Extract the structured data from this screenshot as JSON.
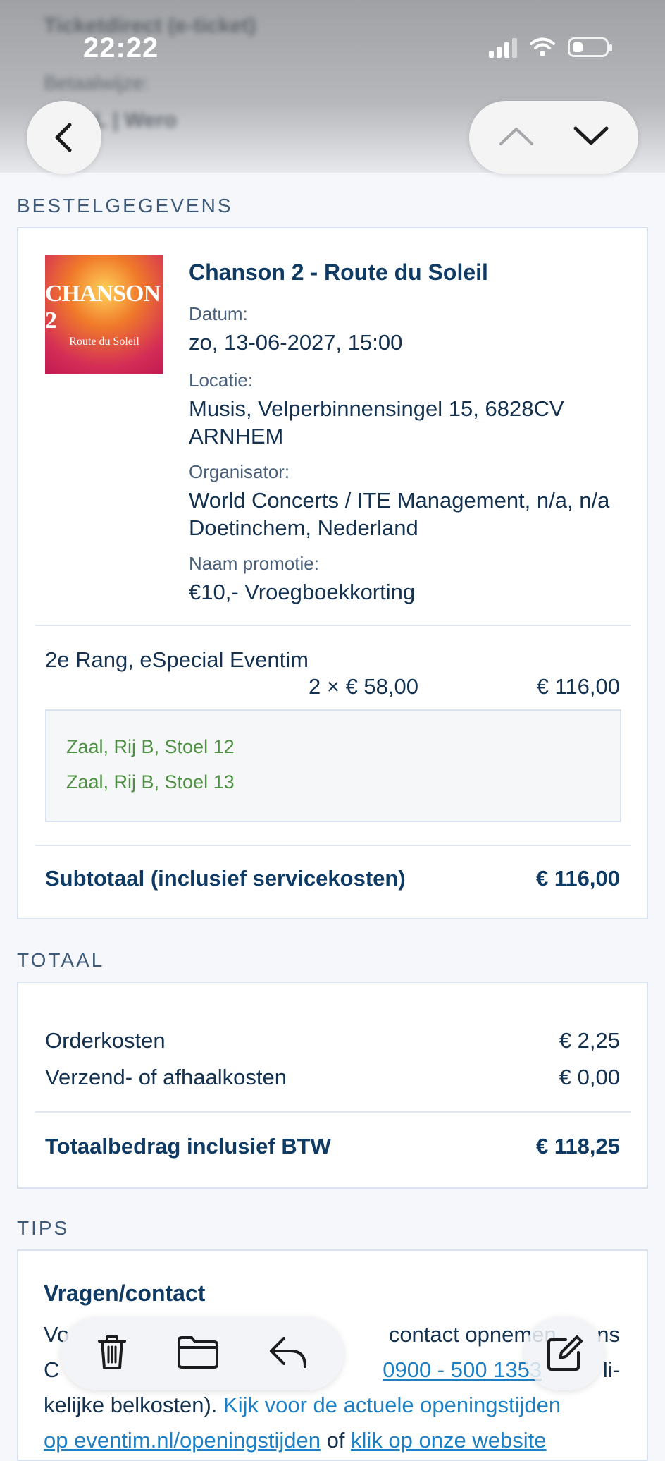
{
  "status_bar": {
    "time": "22:22"
  },
  "background_text": {
    "line1": "Ticketdirect (e-ticket)",
    "line2": "Betaalwijze:",
    "line3": "iDEAL | Wero"
  },
  "order_section": {
    "heading": "BESTELGEGEVENS",
    "event": {
      "poster_title": "CHANSON 2",
      "poster_subtitle": "Route du Soleil",
      "title": "Chanson 2 - Route du Soleil",
      "date_label": "Datum:",
      "date_value": "zo, 13-06-2027, 15:00",
      "location_label": "Locatie:",
      "location_value": "Musis, Velperbinnensingel 15, 6828CV ARNHEM",
      "organizer_label": "Organisator:",
      "organizer_value": "World Concerts / ITE Management, n/a, n/a Doetinchem, Nederland",
      "promo_label": "Naam promotie:",
      "promo_value": "€10,- Vroegboekkorting"
    },
    "ticket": {
      "category": "2e Rang, eSpecial Eventim",
      "quantity_price": "2 × € 58,00",
      "line_total": "€ 116,00",
      "seats": [
        "Zaal, Rij B, Stoel 12",
        "Zaal, Rij B, Stoel 13"
      ]
    },
    "subtotal_label": "Subtotaal (inclusief servicekosten)",
    "subtotal_value": "€ 116,00"
  },
  "total_section": {
    "heading": "TOTAAL",
    "order_costs_label": "Orderkosten",
    "order_costs_value": "€ 2,25",
    "shipping_label": "Verzend- of afhaalkosten",
    "shipping_value": "€ 0,00",
    "total_label": "Totaalbedrag inclusief BTW",
    "total_value": "€ 118,25"
  },
  "tips_section": {
    "heading": "TIPS",
    "contact_title": "Vragen/contact",
    "line1_start": "Vo",
    "line1_end": "contact opnemen",
    "line1_tail": "ns",
    "line2_start": "C",
    "line2_phone": "0900 - 500 1353",
    "line2_tail": "li-",
    "line3_start": "kelijke belkosten).",
    "line3_link": "Kijk voor de actuele openingstijden",
    "line4_link1": "op eventim.nl/openingstijden",
    "line4_mid": "of",
    "line4_link2": "klik op onze website"
  },
  "icons": {
    "back": "chevron-left-icon",
    "up": "chevron-up-icon",
    "down": "chevron-down-icon",
    "trash": "trash-icon",
    "folder": "folder-icon",
    "reply": "reply-icon",
    "compose": "compose-icon"
  }
}
